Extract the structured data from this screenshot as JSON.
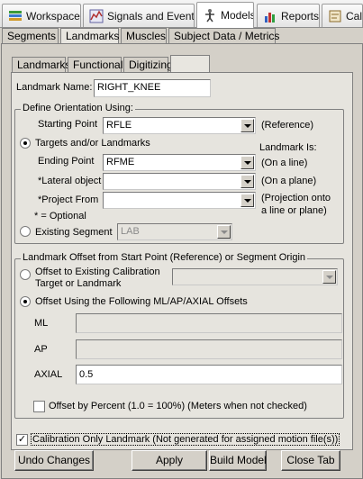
{
  "top_tabs": [
    {
      "label": "Workspace",
      "icon": "workspace-icon"
    },
    {
      "label": "Signals and Events",
      "icon": "signals-icon"
    },
    {
      "label": "Models",
      "icon": "models-icon"
    },
    {
      "label": "Reports",
      "icon": "reports-icon"
    },
    {
      "label": "CalT",
      "icon": "calt-icon"
    }
  ],
  "model_tabs": [
    "Segments",
    "Landmarks",
    "Muscles",
    "Subject Data / Metrics"
  ],
  "landmark_tabs": [
    "Landmarks",
    "Functional",
    "Digitizing",
    ""
  ],
  "landmark_name_label": "Landmark Name:",
  "landmark_name": "RIGHT_KNEE",
  "orientation": {
    "legend": "Define Orientation Using:",
    "starting_point_label": "Starting Point",
    "starting_point_value": "RFLE",
    "reference_note": "(Reference)",
    "targets_label": "Targets and/or Landmarks",
    "landmark_is_label": "Landmark Is:",
    "ending_point_label": "Ending Point",
    "ending_point_value": "RFME",
    "on_line_note": "(On a line)",
    "lateral_label": "*Lateral object",
    "lateral_value": "",
    "on_plane_note": "(On a plane)",
    "project_label": "*Project From",
    "project_value": "",
    "projection_note_1": "(Projection onto",
    "projection_note_2": "a line or plane)",
    "optional_note": "* = Optional",
    "existing_segment_label": "Existing Segment",
    "existing_segment_value": "LAB"
  },
  "offset": {
    "legend": "Landmark Offset from Start Point (Reference) or Segment Origin",
    "calib_option_line1": "Offset to Existing Calibration",
    "calib_option_line2": "Target or Landmark",
    "calib_value": "",
    "ml_ap_option": "Offset Using the Following ML/AP/AXIAL Offsets",
    "ml_label": "ML",
    "ml_value": "",
    "ap_label": "AP",
    "ap_value": "",
    "axial_label": "AXIAL",
    "axial_value": "0.5",
    "percent_label": "Offset by Percent (1.0 = 100%) (Meters when not checked)"
  },
  "calibration_only_label": "Calibration Only Landmark (Not generated for assigned motion file(s))",
  "buttons": {
    "undo": "Undo Changes",
    "apply": "Apply",
    "build": "Build Model",
    "close": "Close Tab"
  },
  "colors": {
    "window_bg": "#d4d0c8",
    "panel_bg": "#e6e4de",
    "field_bg": "#ffffff"
  }
}
